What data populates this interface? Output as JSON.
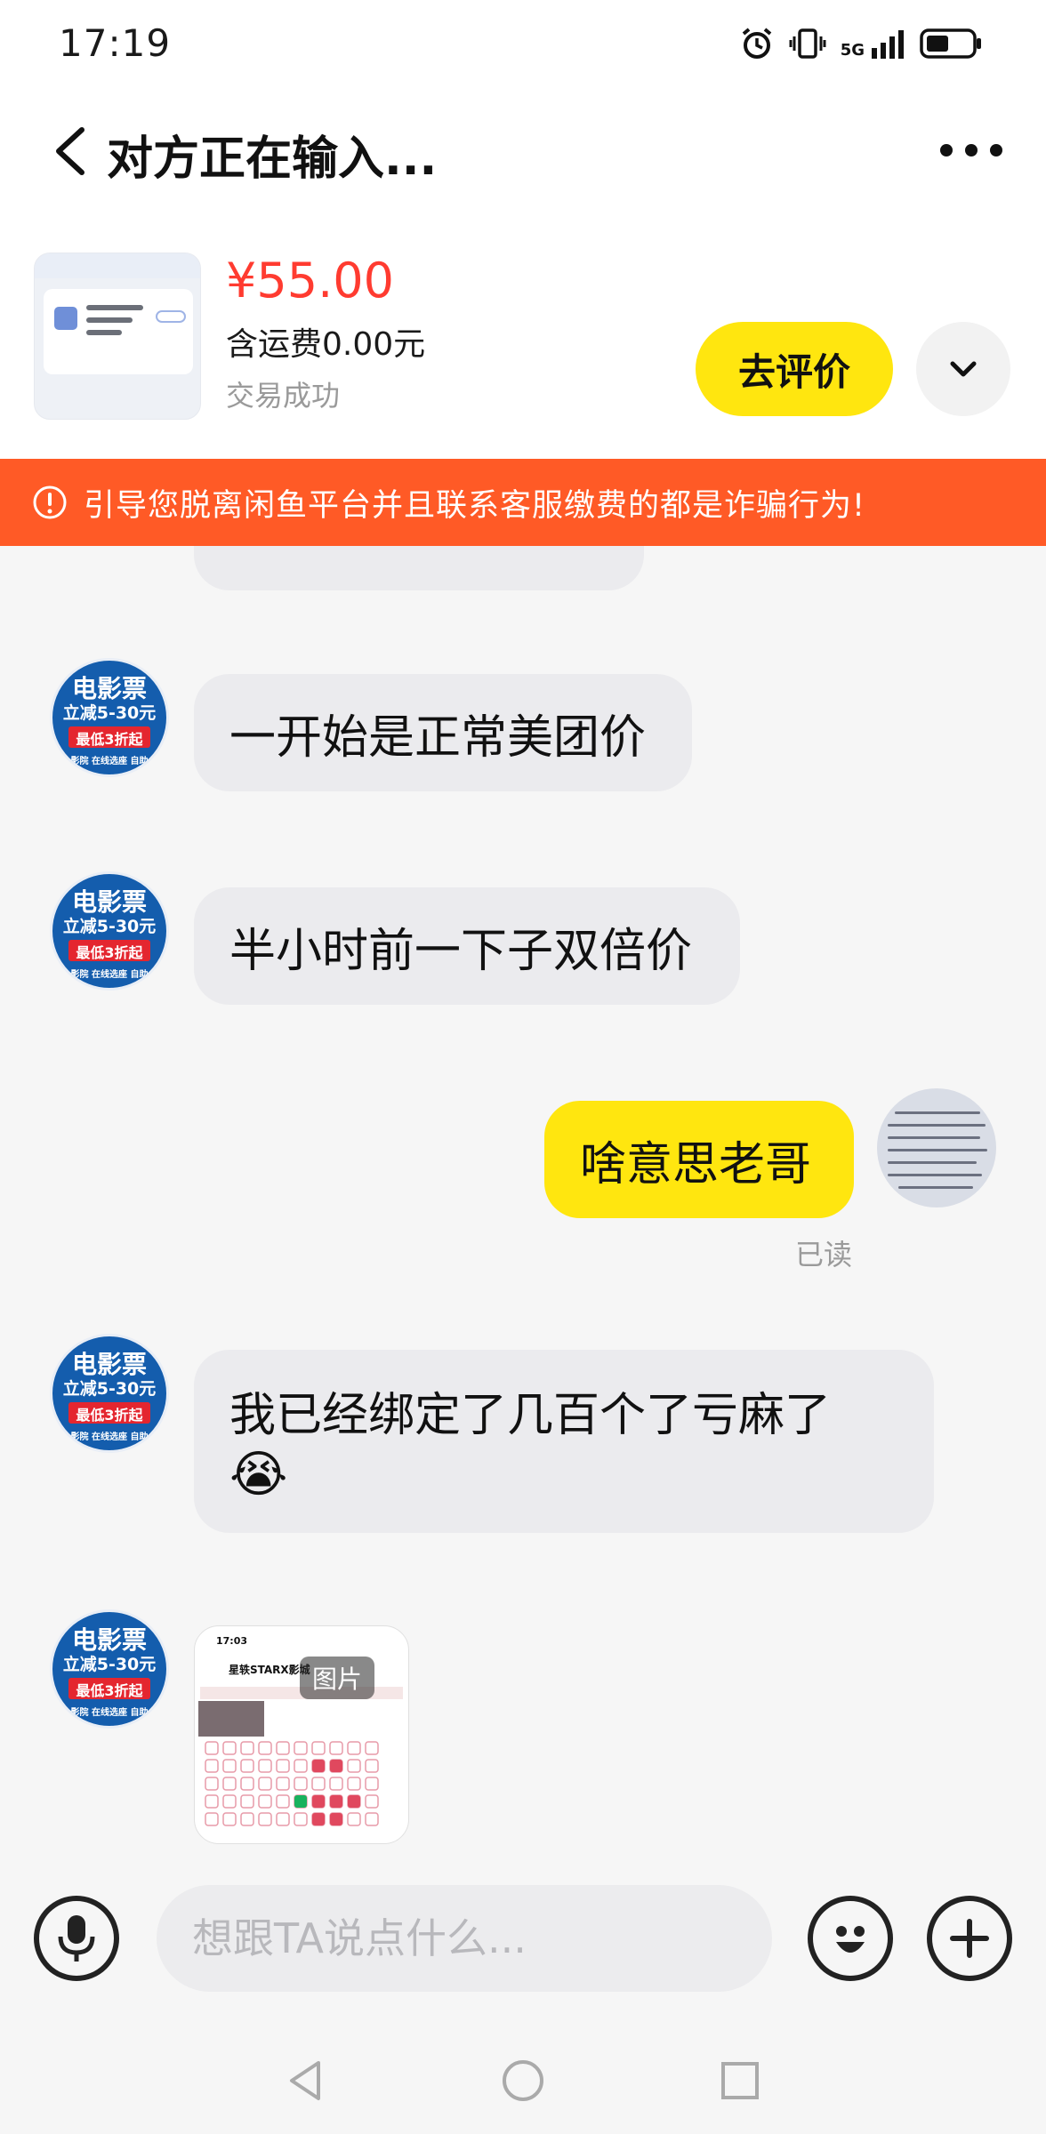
{
  "status_bar": {
    "time": "17:19",
    "network": "5G",
    "icons": [
      "alarm-icon",
      "vibrate-icon",
      "signal-icon",
      "battery-icon"
    ]
  },
  "header": {
    "title": "对方正在输入...",
    "back_icon": "chevron-left-icon",
    "more_icon": "more-dots-icon"
  },
  "product": {
    "price": "¥55.00",
    "shipping": "含运费0.00元",
    "status": "交易成功",
    "review_button": "去评价",
    "expand_icon": "chevron-down-icon"
  },
  "warning": {
    "text": "引导您脱离闲鱼平台并且联系客服缴费的都是诈骗行为!",
    "icon": "alert-circle-icon",
    "color": "#ff5a26"
  },
  "shop_avatar": {
    "line1": "电影票",
    "line2": "立减5-30元",
    "line3": "最低3折起",
    "line4": "影院 在线选座 自助"
  },
  "messages": [
    {
      "side": "in",
      "text": "一开始是正常美团价"
    },
    {
      "side": "in",
      "text": "半小时前一下子双倍价"
    },
    {
      "side": "out",
      "text": "啥意思老哥",
      "read": "已读"
    },
    {
      "side": "in",
      "text": "我已经绑定了几百个了亏麻了",
      "emoji": "😭"
    },
    {
      "side": "in",
      "type": "image",
      "label": "图片",
      "image_title": "星轶STARX影城",
      "image_time": "17:03"
    }
  ],
  "input_bar": {
    "placeholder": "想跟TA说点什么...",
    "voice_icon": "microphone-icon",
    "emoji_icon": "smiley-icon",
    "add_icon": "plus-icon"
  },
  "nav_bar": {
    "icons": [
      "back-triangle-icon",
      "home-circle-icon",
      "recents-square-icon"
    ]
  },
  "colors": {
    "accent_yellow": "#ffe60f",
    "price_red": "#ff3b30",
    "bubble_gray": "#ebebee",
    "background": "#f6f6f6"
  }
}
